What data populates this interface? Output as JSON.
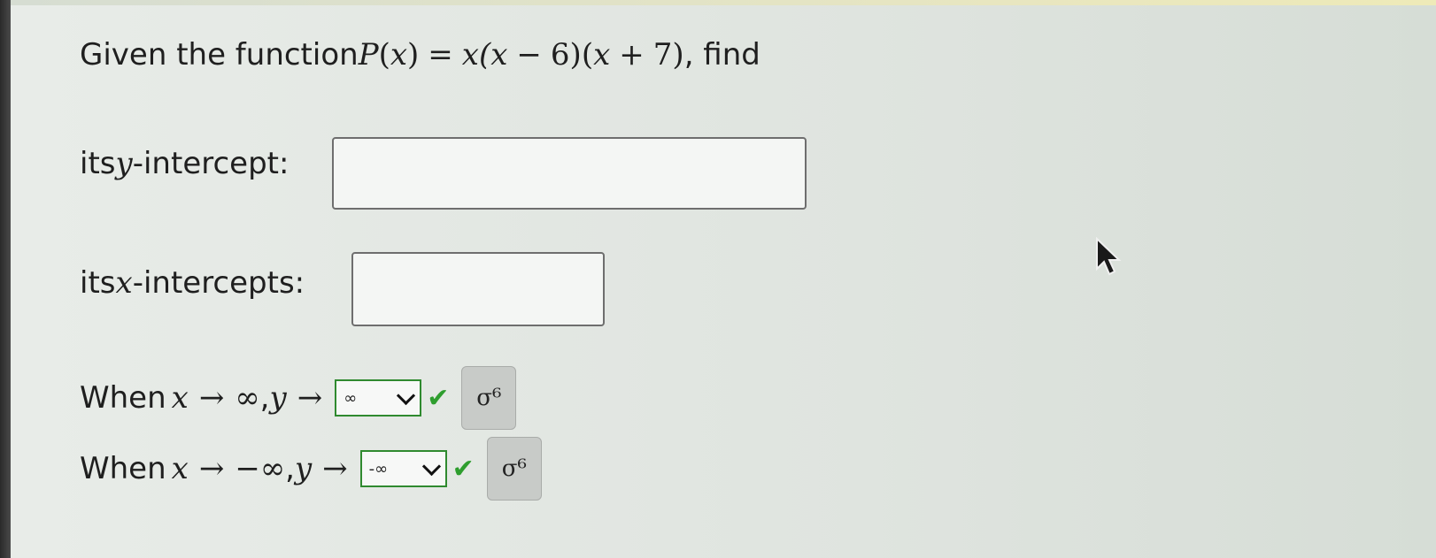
{
  "question": {
    "prefix": "Given the function ",
    "func": "P",
    "var": "x",
    "equals": "=",
    "expr_part1": "x(x",
    "minus": "−",
    "six": "6)(",
    "expr_part2": "x",
    "plus": "+",
    "seven": "7)",
    "suffix": ", find"
  },
  "y_intercept": {
    "label_pre": "its ",
    "label_var": "y",
    "label_post": "-intercept:",
    "value": ""
  },
  "x_intercepts": {
    "label_pre": "its ",
    "label_var": "x",
    "label_post": "-intercepts:",
    "value": ""
  },
  "limits": [
    {
      "when": "When ",
      "x": "x",
      "arrow": "→",
      "target": "∞",
      "comma": ", ",
      "y": "y",
      "arrow2": "→",
      "selected": "∞",
      "correct": true,
      "check_icon": "checkmark-icon",
      "button_icon": "symbolic-formatting-icon",
      "button_glyph": "σ⁶"
    },
    {
      "when": "When ",
      "x": "x",
      "arrow": "→",
      "target": "−∞",
      "comma": ", ",
      "y": "y",
      "arrow2": "→",
      "selected": "-∞",
      "correct": true,
      "check_icon": "checkmark-icon",
      "button_icon": "symbolic-formatting-icon",
      "button_glyph": "σ⁶"
    }
  ],
  "colors": {
    "correct_green": "#2e9e2e",
    "select_border": "#2f8a2f"
  }
}
